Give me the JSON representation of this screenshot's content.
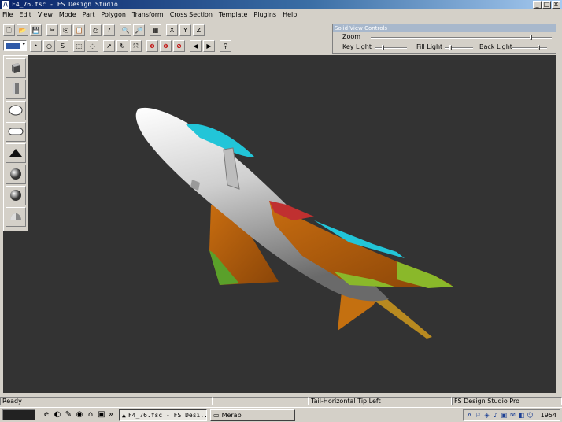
{
  "window": {
    "title": "F4_76.fsc - FS Design Studio",
    "minimize": "_",
    "maximize": "□",
    "close": "✕"
  },
  "menu": [
    "File",
    "Edit",
    "View",
    "Mode",
    "Part",
    "Polygon",
    "Transform",
    "Cross Section",
    "Template",
    "Plugins",
    "Help"
  ],
  "toolbar1": [
    {
      "name": "new-file-button",
      "glyph": "🗋"
    },
    {
      "name": "open-file-button",
      "glyph": "📂"
    },
    {
      "name": "save-button",
      "glyph": "💾"
    },
    {
      "sep": true
    },
    {
      "name": "cut-button",
      "glyph": "✂"
    },
    {
      "name": "copy-button",
      "glyph": "⎘"
    },
    {
      "name": "paste-button",
      "glyph": "📋"
    },
    {
      "sep": true
    },
    {
      "name": "print-button",
      "glyph": "⎙"
    },
    {
      "name": "help-button",
      "glyph": "?"
    },
    {
      "sep": true
    },
    {
      "name": "zoom-in-button",
      "glyph": "🔍"
    },
    {
      "name": "zoom-out-button",
      "glyph": "🔎"
    },
    {
      "sep": true
    },
    {
      "name": "grid-button",
      "glyph": "▦"
    },
    {
      "sep": true
    },
    {
      "name": "mirror-x-button",
      "glyph": "X"
    },
    {
      "name": "mirror-y-button",
      "glyph": "Y"
    },
    {
      "name": "mirror-z-button",
      "glyph": "Z"
    }
  ],
  "toolbar2": [
    {
      "name": "select-point-button",
      "glyph": "•"
    },
    {
      "name": "select-circle-button",
      "glyph": "○"
    },
    {
      "name": "select-lasso-button",
      "glyph": "S"
    },
    {
      "sep": true
    },
    {
      "name": "select-box-button",
      "glyph": "⬚"
    },
    {
      "name": "select-faded-button",
      "glyph": "◌"
    },
    {
      "sep": true
    },
    {
      "name": "move-button",
      "glyph": "↗"
    },
    {
      "name": "rotate-button",
      "glyph": "↻"
    },
    {
      "name": "scale-button",
      "glyph": "⤧"
    },
    {
      "sep": true
    },
    {
      "name": "delete-button",
      "glyph": "⊗",
      "red": true
    },
    {
      "name": "delete-polygon-button",
      "glyph": "⊗",
      "red": true
    },
    {
      "name": "delete-part-button",
      "glyph": "⊘",
      "red": true
    },
    {
      "sep": true
    },
    {
      "name": "previous-button",
      "glyph": "◀"
    },
    {
      "name": "next-button",
      "glyph": "▶"
    },
    {
      "sep": true
    },
    {
      "name": "binoculars-button",
      "glyph": "⚲"
    }
  ],
  "solid_view": {
    "title": "Solid View Controls",
    "zoom_label": "Zoom",
    "key_light_label": "Key Light",
    "fill_light_label": "Fill Light",
    "back_light_label": "Back Light"
  },
  "palette": [
    {
      "name": "cube-shape-button",
      "shape": "cube"
    },
    {
      "name": "cylinder-shape-button",
      "shape": "cylinder"
    },
    {
      "name": "sphere-shape-button",
      "shape": "ellipse"
    },
    {
      "name": "capsule-shape-button",
      "shape": "capsule"
    },
    {
      "name": "wedge-shape-button",
      "shape": "wedge"
    },
    {
      "name": "geosphere-shape-button",
      "shape": "ball"
    },
    {
      "name": "ball-shape-button",
      "shape": "ball"
    },
    {
      "name": "dome-shape-button",
      "shape": "dome"
    }
  ],
  "status": {
    "left": "Ready",
    "part": "Tail-Horizontal Tip Left",
    "product": "FS Design Studio Pro"
  },
  "taskbar": {
    "quick_launch": [
      "e",
      "◐",
      "✎",
      "◉",
      "⌂",
      "▣"
    ],
    "more": "»",
    "tasks": [
      {
        "label": "F4_76.fsc - FS Desi...",
        "active": true
      },
      {
        "label": "Merab",
        "active": false
      }
    ],
    "clock": "1954"
  }
}
